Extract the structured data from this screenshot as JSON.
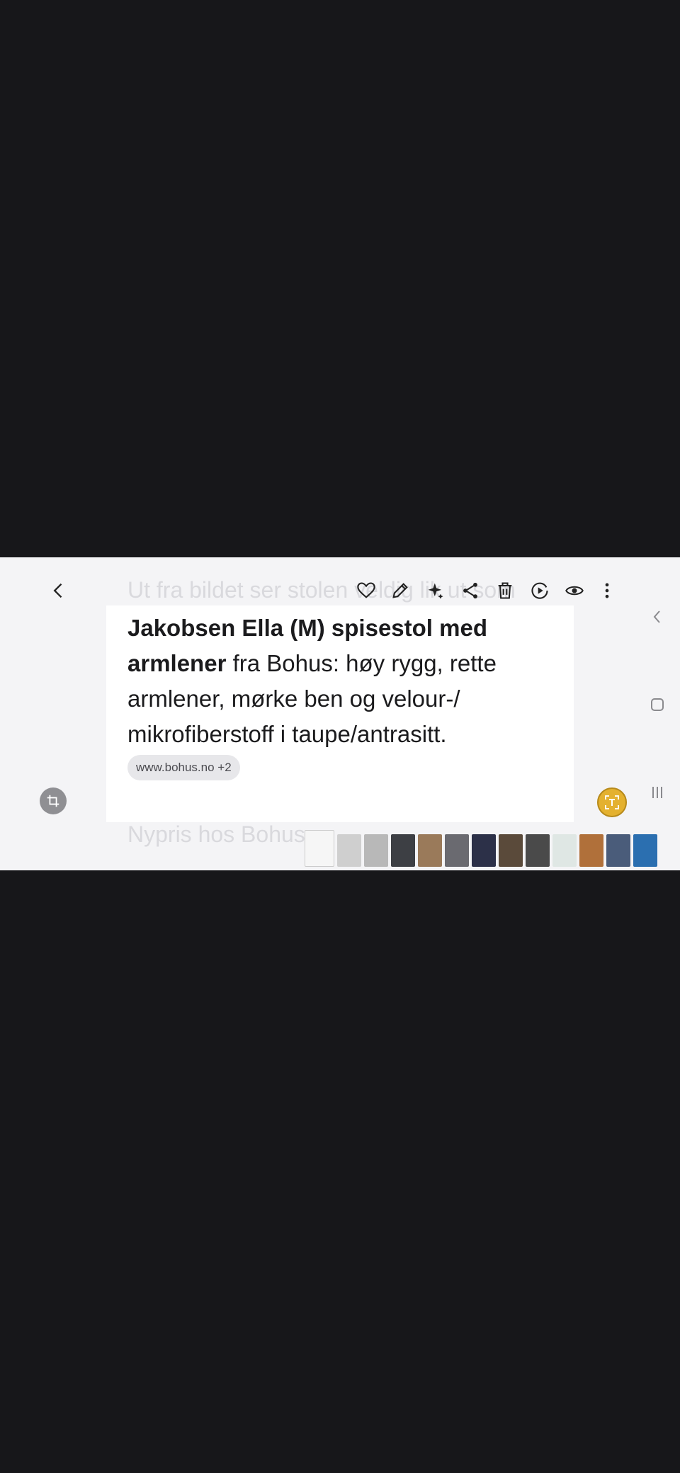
{
  "viewer": {
    "faded_top_text": "Ut fra bildet ser stolen veldig lik ut som",
    "bold_part_1": "Jakobsen Ella (M) spisestol med armlener",
    "regular_part_1": " fra Bohus: høy rygg, rette armlener, mørke ben og velour-/ mikrofiberstoff i taupe/antrasitt.",
    "source_chip": "www.bohus.no +2",
    "faded_bottom_text": "Nypris hos Bohus"
  },
  "toolbar": {
    "icons": [
      "back-icon",
      "heart-icon",
      "pencil-icon",
      "sparkle-icon",
      "share-icon",
      "trash-icon",
      "motion-play-icon",
      "eye-icon",
      "more-vertical-icon"
    ]
  },
  "filmstrip": {
    "thumbnails": [
      {
        "name": "document-thumb",
        "color": "#f6f6f6"
      },
      {
        "name": "sofa-thumb",
        "color": "#cfcfcf"
      },
      {
        "name": "fabric-thumb",
        "color": "#b8b8b8"
      },
      {
        "name": "dark-room-thumb",
        "color": "#3d3f44"
      },
      {
        "name": "floor-items-thumb",
        "color": "#9a7a5a"
      },
      {
        "name": "grey-thumb",
        "color": "#6a6a70"
      },
      {
        "name": "chair-thumb",
        "color": "#2c3048"
      },
      {
        "name": "room-thumb",
        "color": "#5a4a3a"
      },
      {
        "name": "video-thumb",
        "color": "#4a4a4a"
      },
      {
        "name": "note-thumb",
        "color": "#dfe7e4"
      },
      {
        "name": "leather-thumb",
        "color": "#b0703a"
      },
      {
        "name": "colorful-thumb",
        "color": "#4a5c7a"
      },
      {
        "name": "blue-thumb",
        "color": "#2b6fb0"
      }
    ]
  },
  "colors": {
    "accent_text_extract": "#e4b12f",
    "background": "#17171a"
  }
}
